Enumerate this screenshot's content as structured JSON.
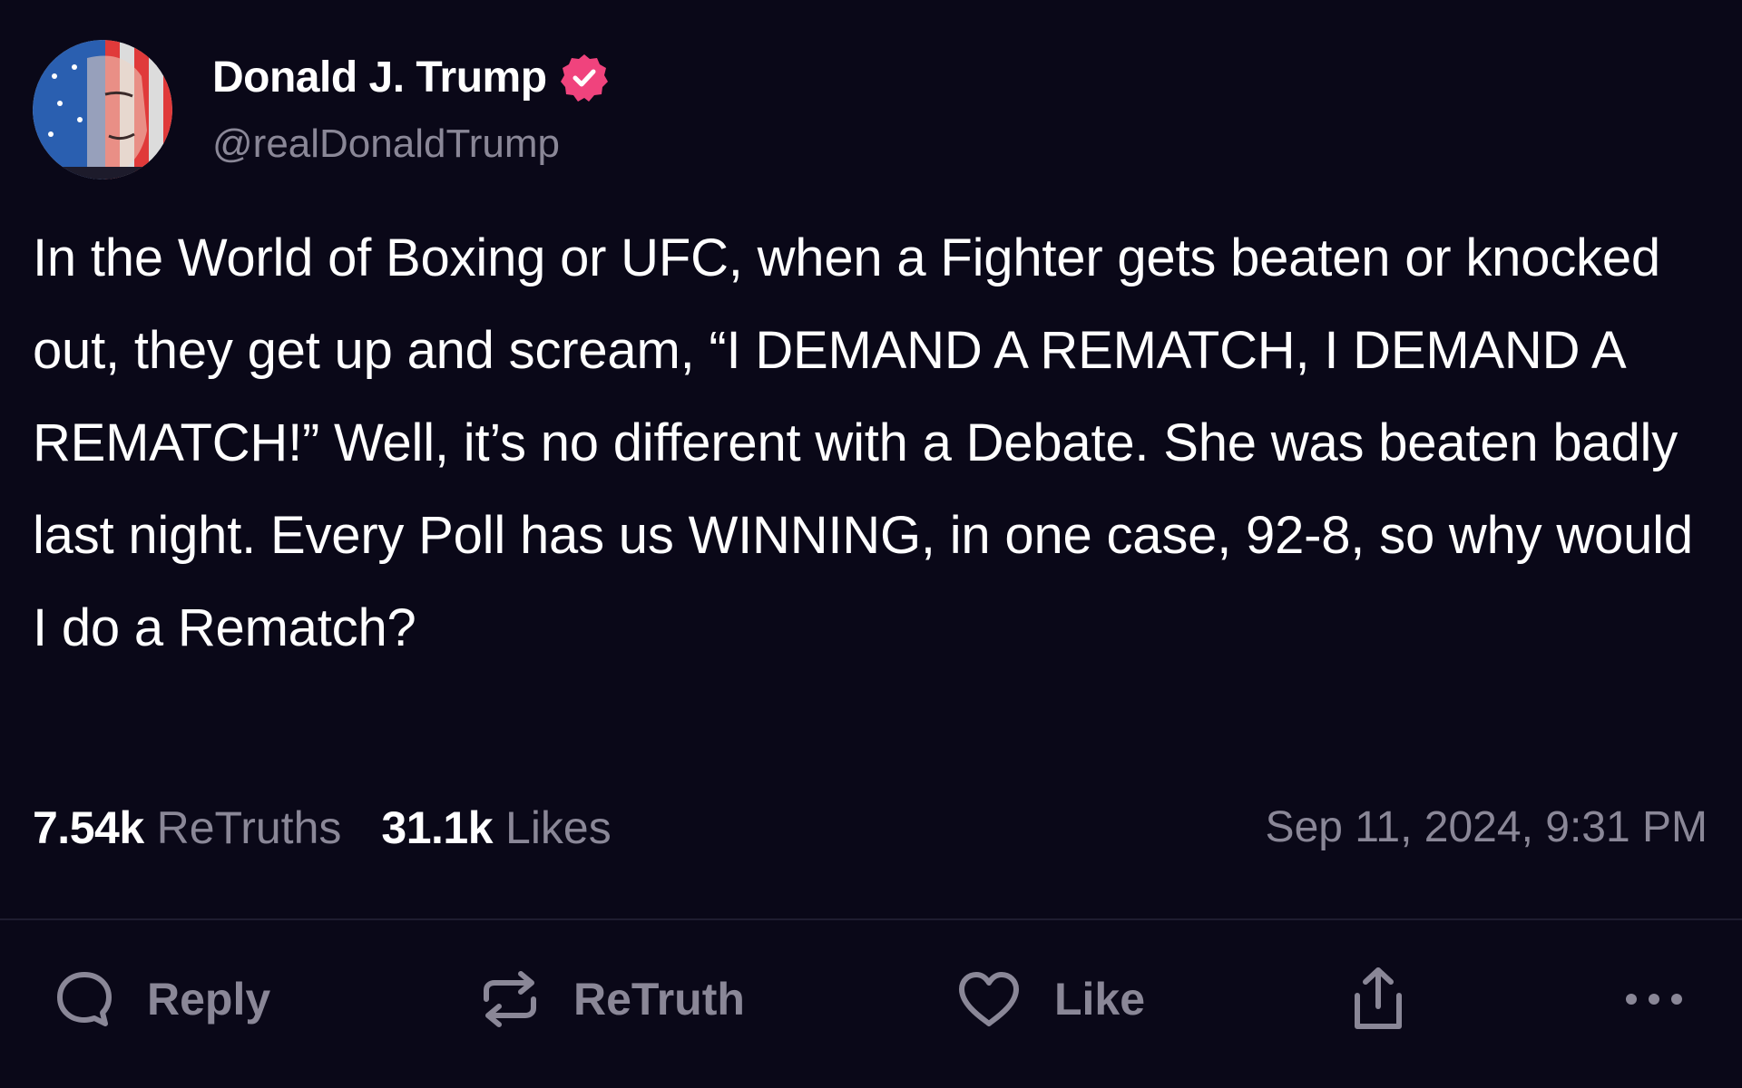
{
  "post": {
    "author": {
      "display_name": "Donald J. Trump",
      "handle": "@realDonaldTrump",
      "verified": true,
      "verified_color": "#f0437d"
    },
    "text": "In the World of Boxing or UFC, when a Fighter gets beaten or knocked out, they get up and scream, “I DEMAND A REMATCH, I DEMAND A REMATCH!” Well, it’s no different with a Debate. She was beaten badly last night. Every Poll has us WINNING, in one case, 92-8, so why would I do a Rematch?",
    "stats": {
      "retruths_count": "7.54k",
      "retruths_label": "ReTruths",
      "likes_count": "31.1k",
      "likes_label": "Likes"
    },
    "timestamp": "Sep 11, 2024, 9:31 PM"
  },
  "actions": {
    "reply": {
      "label": "Reply",
      "icon": "chat-bubble-icon"
    },
    "retruth": {
      "label": "ReTruth",
      "icon": "repost-arrows-icon"
    },
    "like": {
      "label": "Like",
      "icon": "heart-icon"
    },
    "share": {
      "icon": "share-upload-icon"
    },
    "more": {
      "icon": "ellipsis-icon"
    }
  },
  "colors": {
    "background": "#0a0818",
    "muted_text": "#8a8797",
    "primary_text": "#ffffff"
  }
}
